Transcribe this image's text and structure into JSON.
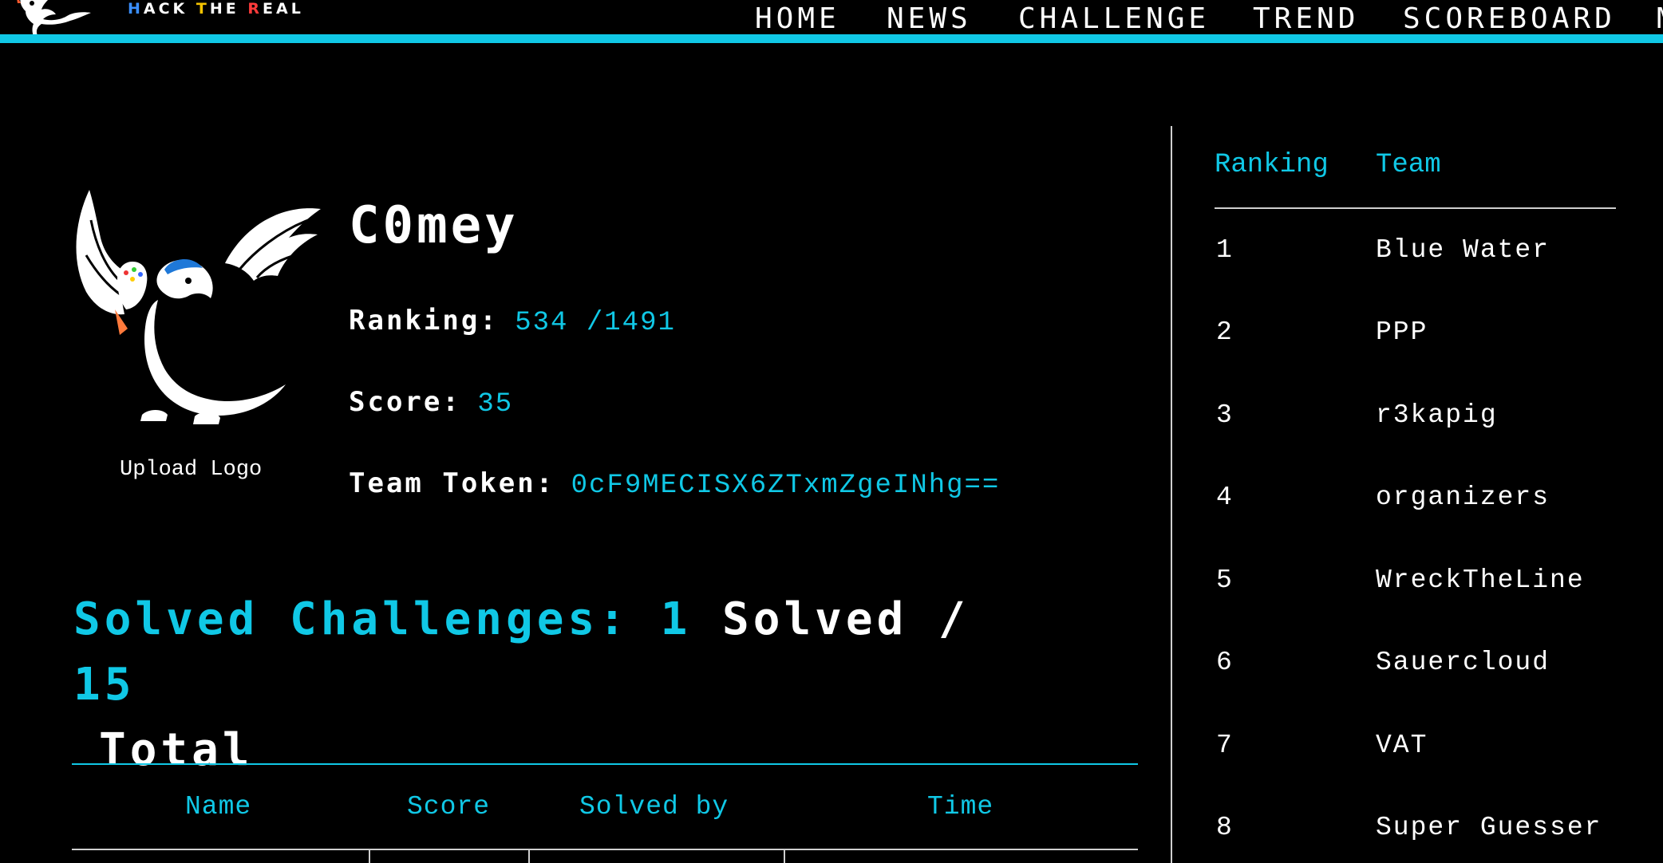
{
  "header": {
    "brand": {
      "h": "H",
      "ack": "ACK ",
      "t": "T",
      "he": "HE ",
      "r": "R",
      "eal": "EAL"
    },
    "nav": [
      {
        "label": "HOME"
      },
      {
        "label": "NEWS"
      },
      {
        "label": "CHALLENGE"
      },
      {
        "label": "TREND"
      },
      {
        "label": "SCOREBOARD"
      },
      {
        "label": "M"
      }
    ],
    "accent_color": "#10c8e6"
  },
  "profile": {
    "logo_icon": "dragon-logo-icon",
    "upload_label": "Upload Logo",
    "team_name": "C0mey",
    "ranking_label": "Ranking:",
    "ranking_value": "534 /1491",
    "score_label": "Score:",
    "score_value": "35",
    "token_label": "Team Token:",
    "token_value": "0cF9MECISX6ZTxmZgeINhg=="
  },
  "solved": {
    "label": "Solved Challenges:",
    "count": "1",
    "solved_word": "Solved /",
    "total": "15",
    "total_word": "Total"
  },
  "challenges_table": {
    "columns": [
      "Name",
      "Score",
      "Solved by",
      "Time"
    ],
    "rows": []
  },
  "scoreboard": {
    "headers": {
      "ranking": "Ranking",
      "team": "Team"
    },
    "rows": [
      {
        "rank": "1",
        "team": "Blue Water"
      },
      {
        "rank": "2",
        "team": "PPP"
      },
      {
        "rank": "3",
        "team": "r3kapig"
      },
      {
        "rank": "4",
        "team": "organizers"
      },
      {
        "rank": "5",
        "team": "WreckTheLine"
      },
      {
        "rank": "6",
        "team": "Sauercloud"
      },
      {
        "rank": "7",
        "team": "VAT"
      },
      {
        "rank": "8",
        "team": "Super Guesser"
      }
    ]
  }
}
